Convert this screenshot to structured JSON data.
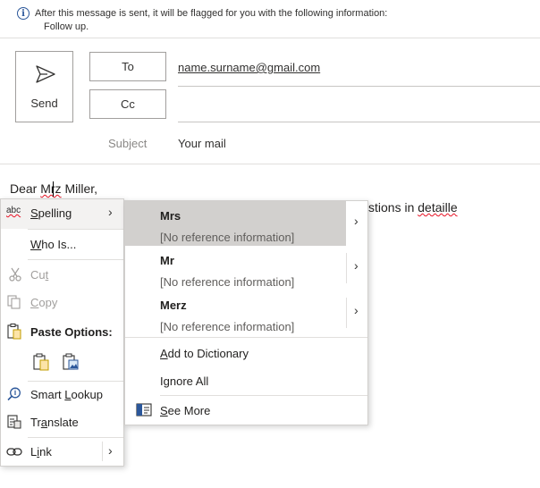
{
  "info": {
    "line1": "After this message is sent, it will be flagged for you with the following information:",
    "line2": "Follow up."
  },
  "compose": {
    "send_label": "Send",
    "to_label": "To",
    "cc_label": "Cc",
    "to_value": "name.surname@gmail.com",
    "subject_label": "Subject",
    "subject_value": "Your mail"
  },
  "body": {
    "greeting_pre": "Dear ",
    "greeting_misspelled": "Mrz",
    "greeting_post": " Miller,",
    "line_tail_pre": "stions in ",
    "line_tail_misspelled": "detaille"
  },
  "context_menu": {
    "spelling": {
      "icon_text": "abc",
      "label_accel": "S",
      "label_rest": "pelling"
    },
    "who_is": {
      "label_accel": "W",
      "label_rest": "ho Is..."
    },
    "cut": {
      "label_pre": "Cu",
      "label_accel": "t"
    },
    "copy": {
      "label_accel": "C",
      "label_rest": "opy"
    },
    "paste_options": "Paste Options:",
    "smart_lookup": {
      "label_pre": "Smart ",
      "label_accel": "L",
      "label_rest": "ookup"
    },
    "translate": {
      "label_pre": "Tr",
      "label_accel": "a",
      "label_rest": "nslate"
    },
    "link": {
      "label_pre": "L",
      "label_accel": "i",
      "label_rest": "nk"
    }
  },
  "submenu": {
    "suggestions": [
      {
        "word": "Mrs",
        "ref": "[No reference information]"
      },
      {
        "word": "Mr",
        "ref": "[No reference information]"
      },
      {
        "word": "Merz",
        "ref": "[No reference information]"
      }
    ],
    "add_to_dictionary": {
      "label_accel": "A",
      "label_rest": "dd to Dictionary"
    },
    "ignore_all": {
      "label_pre": "I",
      "label_accel": "g",
      "label_rest": "nore All"
    },
    "see_more": {
      "label_accel": "S",
      "label_rest": "ee More"
    }
  },
  "colors": {
    "accent": "#2b579a",
    "misspell": "#e81123",
    "selected": "#d2d0ce"
  }
}
